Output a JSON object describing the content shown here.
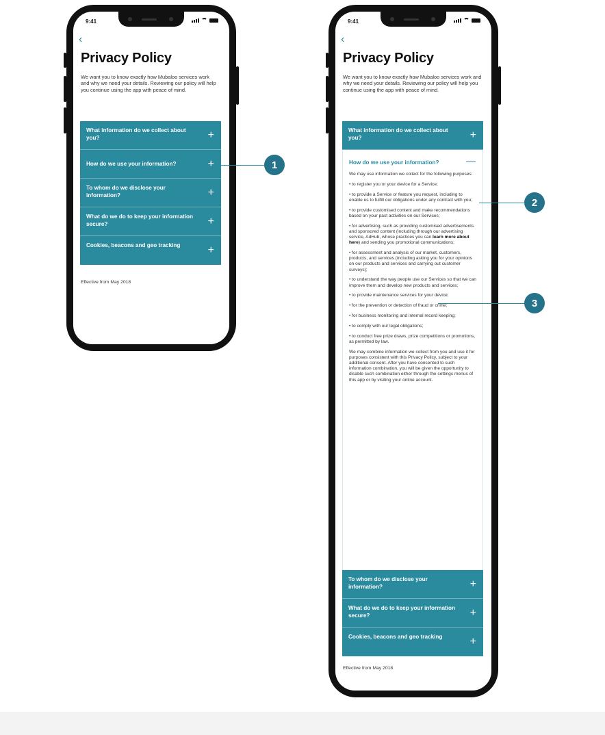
{
  "status_time": "9:41",
  "back_icon": "chevron-left-icon",
  "title": "Privacy Policy",
  "intro": "We want you to know exactly how Mubaloo services work and why we need your details. Reviewing our policy will help you continue using the app with peace of mind.",
  "accordion": [
    {
      "label": "What information do we collect about you?"
    },
    {
      "label": "How do we use your information?"
    },
    {
      "label": "To whom do we disclose your information?"
    },
    {
      "label": "What do we do to keep your information secure?"
    },
    {
      "label": "Cookies, beacons and geo tracking"
    }
  ],
  "expand_icon_glyph": "+",
  "collapse_icon_glyph": "—",
  "expanded": {
    "p0": "We may use information we collect for the following purposes:",
    "p1": "• to register you or your device for a Service;",
    "p2": "• to provide a Service or feature you request, including to enable us to fulfill our obligations under any contract with you;",
    "p3": "• to provide customised content and make recommendations based on your past activities on our Services;",
    "p4a": "• for advertising, such as providing customised advertisements and sponsored content (including through our advertising service, AdHub, whose practices you can ",
    "p4link": "learn more about here",
    "p4b": ") and sending you promotional communications;",
    "p5": "• for assessment and analysis of our market, customers, products, and services (including asking you for your opinions on our products and services and carrying out customer surveys);",
    "p6": "• to understand the way people use our Services so that we can improve them and develop new products and services;",
    "p7": "• to provide maintenance services for your device;",
    "p8": "• for the prevention or detection of fraud or crime;",
    "p9": "• for business monitoring and internal record keeping;",
    "p10": "• to comply with our legal obligations;",
    "p11": "• to conduct free prize draws, prize competitions or promotions, as permitted by law.",
    "p12": "We may combine information we collect from you and use it for purposes consistent with this Privacy Policy, subject to your additional consent. After you have consented to such information combination, you will be given the opportunity to disable such combination either through the settings menus of this app or by visiting your online account."
  },
  "effective": "Effective from May 2018",
  "callouts": [
    "1",
    "2",
    "3"
  ],
  "colors": {
    "accent": "#2a8a9e",
    "badge": "#25738a"
  }
}
